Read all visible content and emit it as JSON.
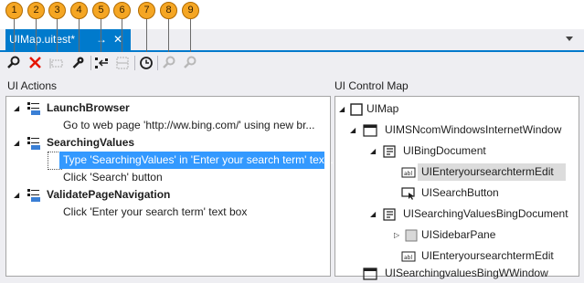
{
  "callouts": [
    "1",
    "2",
    "3",
    "4",
    "5",
    "6",
    "7",
    "8",
    "9"
  ],
  "tab": {
    "title": "UIMap.uitest*",
    "pin_glyph": "→",
    "close_glyph": "✕"
  },
  "toolbar": {
    "icons": [
      "find-icon",
      "delete-icon",
      "rename-icon",
      "properties-icon",
      "insert-step-icon",
      "split-icon",
      "delay-icon",
      "locate-all-icon",
      "locate-icon"
    ],
    "colors": {
      "accent": "#007acc",
      "delete": "#e51400",
      "selection": "#3399ff"
    }
  },
  "ui_actions": {
    "label": "UI Actions",
    "items": [
      {
        "kind": "group",
        "text": "LaunchBrowser"
      },
      {
        "kind": "step",
        "text": "Go to web page 'http://ww.bing.com/' using new br..."
      },
      {
        "kind": "group",
        "text": "SearchingValues"
      },
      {
        "kind": "step",
        "text": "Type 'SearchingValues' in 'Enter your search term' tex...",
        "selected": true
      },
      {
        "kind": "step",
        "text": "Click 'Search' button"
      },
      {
        "kind": "group",
        "text": "ValidatePageNavigation"
      },
      {
        "kind": "step",
        "text": "Click 'Enter your search term' text box"
      }
    ]
  },
  "ui_control_map": {
    "label": "UI Control Map",
    "items": [
      {
        "text": "UIMap",
        "icon": "map-icon",
        "expander": "expanded"
      },
      {
        "text": "UIMSNcomWindowsInternetWindow",
        "icon": "window-icon",
        "expander": "expanded"
      },
      {
        "text": "UIBingDocument",
        "icon": "document-icon",
        "expander": "expanded"
      },
      {
        "text": "UIEnteryoursearchtermEdit",
        "icon": "textbox-icon",
        "highlighted": true
      },
      {
        "text": "UISearchButton",
        "icon": "button-icon"
      },
      {
        "text": "UISearchingValuesBingDocument",
        "icon": "document-icon",
        "expander": "expanded"
      },
      {
        "text": "UISidebarPane",
        "icon": "pane-icon",
        "expander": "collapsed"
      },
      {
        "text": "UIEnteryoursearchtermEdit",
        "icon": "textbox-icon"
      },
      {
        "text": "UISearchingvaluesBingWWindow",
        "icon": "window-icon"
      }
    ]
  }
}
